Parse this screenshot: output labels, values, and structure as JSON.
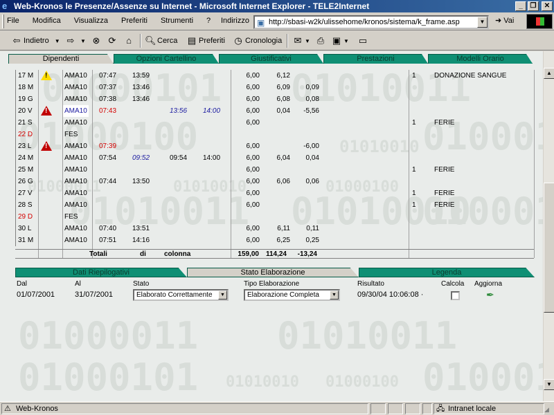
{
  "window": {
    "title": "Web-Kronos le Presenze/Assenze su Internet - Microsoft Internet Explorer - TELE2Internet"
  },
  "menubar": {
    "items": [
      "File",
      "Modifica",
      "Visualizza",
      "Preferiti",
      "Strumenti",
      "?"
    ],
    "address_label": "Indirizzo",
    "address_value": "http://sbasi-w2k/ulissehome/kronos/sistema/k_frame.asp",
    "go_label": "Vai"
  },
  "toolbar": {
    "back": "Indietro",
    "search": "Cerca",
    "favorites": "Preferiti",
    "history": "Cronologia"
  },
  "tabs": [
    "Dipendenti",
    "Opzioni Cartellino",
    "Giustificativi",
    "Prestazioni",
    "Modelli Orario"
  ],
  "rows": [
    {
      "day": "17 M",
      "warn": "yellow",
      "code": "AMA10",
      "t1": "07:47",
      "t2": "13:59",
      "t3": "",
      "t4": "",
      "v1": "6,00",
      "v2": "6,12",
      "v3": "",
      "n": "1",
      "note": "DONAZIONE SANGUE"
    },
    {
      "day": "18 M",
      "warn": "",
      "code": "AMA10",
      "t1": "07:37",
      "t2": "13:46",
      "t3": "",
      "t4": "",
      "v1": "6,00",
      "v2": "6,09",
      "v3": "0,09",
      "n": "",
      "note": ""
    },
    {
      "day": "19 G",
      "warn": "",
      "code": "AMA10",
      "t1": "07:38",
      "t2": "13:46",
      "t3": "",
      "t4": "",
      "v1": "6,00",
      "v2": "6,08",
      "v3": "0,08",
      "n": "",
      "note": ""
    },
    {
      "day": "20 V",
      "warn": "red",
      "code": "AMA10",
      "t1": "07:43",
      "t2": "",
      "t3": "13:56",
      "t4": "14:00",
      "v1": "6,00",
      "v2": "0,04",
      "v3": "-5,56",
      "n": "",
      "note": ""
    },
    {
      "day": "21 S",
      "warn": "",
      "code": "AMA10",
      "t1": "",
      "t2": "",
      "t3": "",
      "t4": "",
      "v1": "6,00",
      "v2": "",
      "v3": "",
      "n": "1",
      "note": "FERIE"
    },
    {
      "day": "22 D",
      "warn": "",
      "code": "FES",
      "t1": "",
      "t2": "",
      "t3": "",
      "t4": "",
      "v1": "",
      "v2": "",
      "v3": "",
      "n": "",
      "note": ""
    },
    {
      "day": "23 L",
      "warn": "red",
      "code": "AMA10",
      "t1": "07:39",
      "t2": "",
      "t3": "",
      "t4": "",
      "v1": "6,00",
      "v2": "",
      "v3": "-6,00",
      "n": "",
      "note": ""
    },
    {
      "day": "24 M",
      "warn": "",
      "code": "AMA10",
      "t1": "07:54",
      "t2": "09:52",
      "t3": "09:54",
      "t4": "14:00",
      "v1": "6,00",
      "v2": "6,04",
      "v3": "0,04",
      "n": "",
      "note": ""
    },
    {
      "day": "25 M",
      "warn": "",
      "code": "AMA10",
      "t1": "",
      "t2": "",
      "t3": "",
      "t4": "",
      "v1": "6,00",
      "v2": "",
      "v3": "",
      "n": "1",
      "note": "FERIE"
    },
    {
      "day": "26 G",
      "warn": "",
      "code": "AMA10",
      "t1": "07:44",
      "t2": "13:50",
      "t3": "",
      "t4": "",
      "v1": "6,00",
      "v2": "6,06",
      "v3": "0,06",
      "n": "",
      "note": ""
    },
    {
      "day": "27 V",
      "warn": "",
      "code": "AMA10",
      "t1": "",
      "t2": "",
      "t3": "",
      "t4": "",
      "v1": "6,00",
      "v2": "",
      "v3": "",
      "n": "1",
      "note": "FERIE"
    },
    {
      "day": "28 S",
      "warn": "",
      "code": "AMA10",
      "t1": "",
      "t2": "",
      "t3": "",
      "t4": "",
      "v1": "6,00",
      "v2": "",
      "v3": "",
      "n": "1",
      "note": "FERIE"
    },
    {
      "day": "29 D",
      "warn": "",
      "code": "FES",
      "t1": "",
      "t2": "",
      "t3": "",
      "t4": "",
      "v1": "",
      "v2": "",
      "v3": "",
      "n": "",
      "note": ""
    },
    {
      "day": "30 L",
      "warn": "",
      "code": "AMA10",
      "t1": "07:40",
      "t2": "13:51",
      "t3": "",
      "t4": "",
      "v1": "6,00",
      "v2": "6,11",
      "v3": "0,11",
      "n": "",
      "note": ""
    },
    {
      "day": "31 M",
      "warn": "",
      "code": "AMA10",
      "t1": "07:51",
      "t2": "14:16",
      "t3": "",
      "t4": "",
      "v1": "6,00",
      "v2": "6,25",
      "v3": "0,25",
      "n": "",
      "note": ""
    }
  ],
  "totals": {
    "w1": "Totali",
    "w2": "di",
    "w3": "colonna",
    "v1": "159,00",
    "v2": "114,24",
    "v3": "-13,24"
  },
  "bottom_tabs": [
    "Dati Riepilogativi",
    "Stato Elaborazione",
    "Legenda"
  ],
  "form": {
    "dal_label": "Dal",
    "dal_value": "01/07/2001",
    "al_label": "Al",
    "al_value": "31/07/2001",
    "stato_label": "Stato",
    "stato_value": "Elaborato Correttamente",
    "tipo_label": "Tipo Elaborazione",
    "tipo_value": "Elaborazione Completa",
    "risultato_label": "Risultato",
    "risultato_value": "09/30/04 10:06:08 ·",
    "calcola_label": "Calcola",
    "aggiorna_label": "Aggiorna"
  },
  "status": {
    "left": "Web-Kronos",
    "zone": "Intranet locale"
  },
  "background_binary": [
    "01000101",
    "01010011",
    "01000100",
    "01010010",
    "01000011",
    "01000101",
    "01010010",
    "01000100"
  ],
  "colors": {
    "red_time": "#d40000",
    "blue_time": "#1a1aa0",
    "holiday": "#d40000",
    "tab_teal": "#0f8f74"
  }
}
